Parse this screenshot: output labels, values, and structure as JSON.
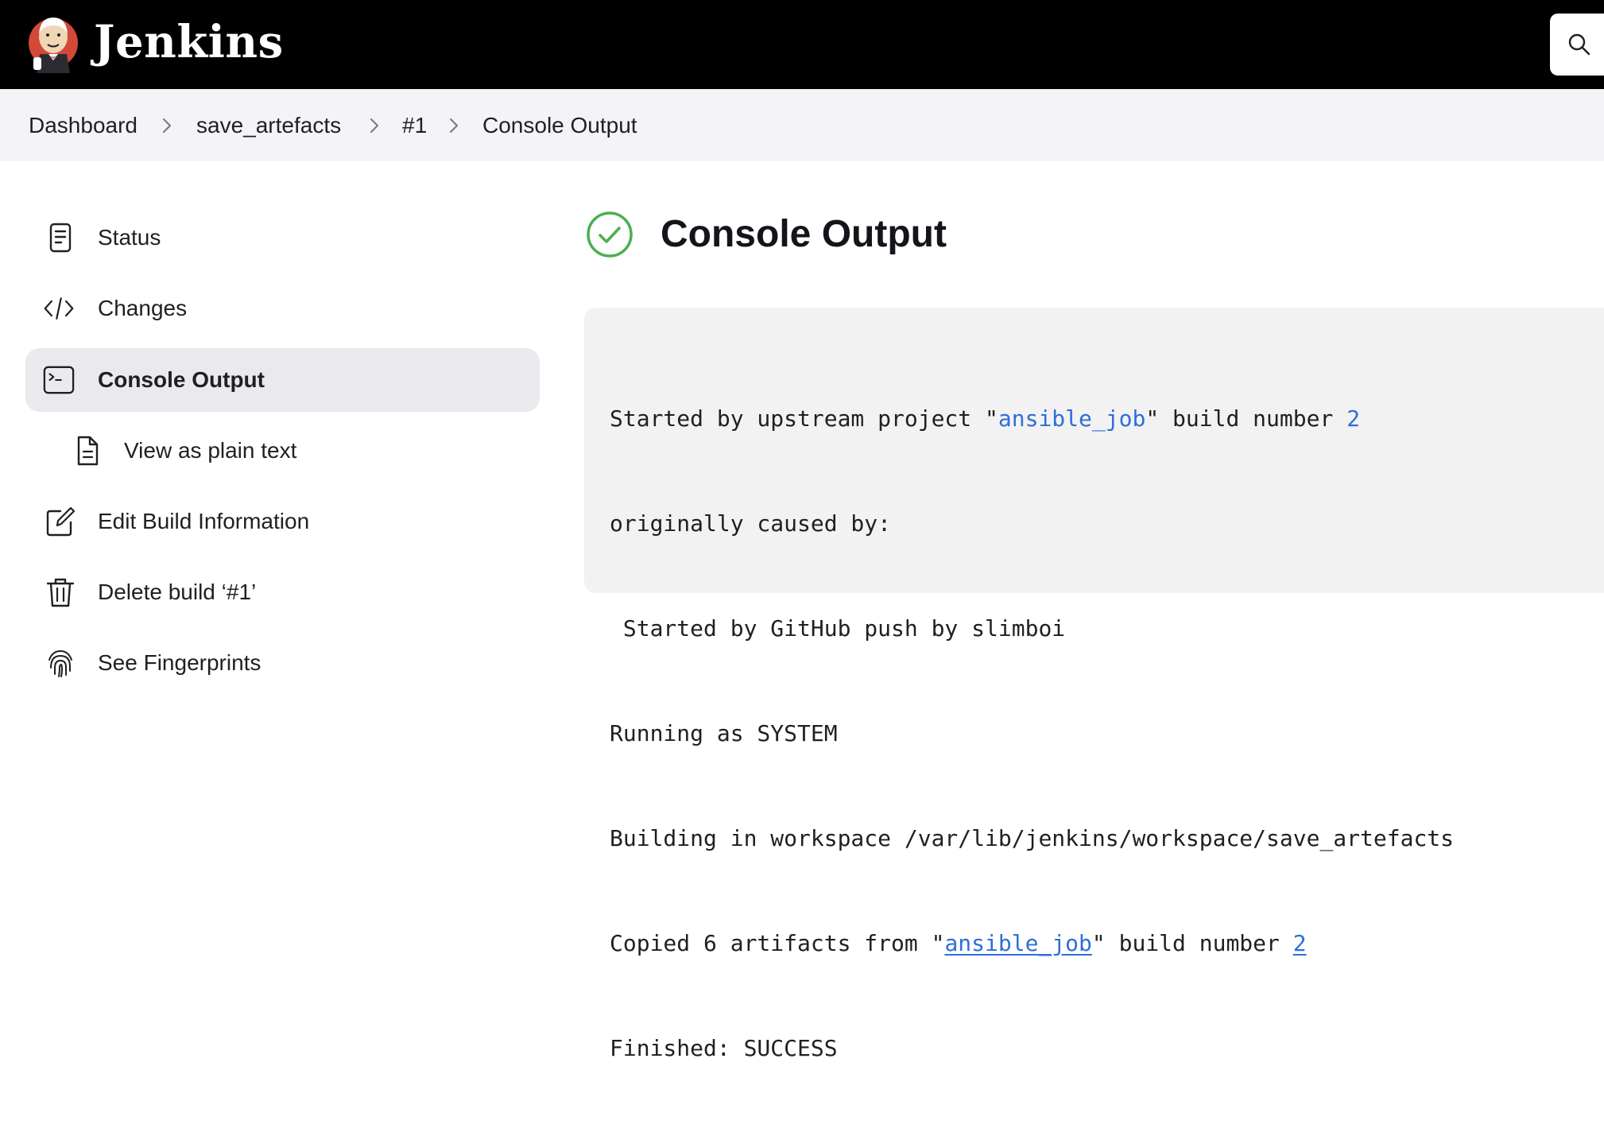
{
  "header": {
    "brand": "Jenkins",
    "logo_icon": "jenkins-butler-logo",
    "search_icon": "search-icon"
  },
  "breadcrumb": {
    "items": [
      "Dashboard",
      "save_artefacts",
      "#1",
      "Console Output"
    ],
    "separator_icon": "chevron-right-icon"
  },
  "sidebar": {
    "items": [
      {
        "label": "Status",
        "icon": "document-icon"
      },
      {
        "label": "Changes",
        "icon": "code-icon"
      },
      {
        "label": "Console Output",
        "icon": "terminal-icon",
        "active": true
      },
      {
        "label": "View as plain text",
        "icon": "file-text-icon"
      },
      {
        "label": "Edit Build Information",
        "icon": "edit-icon"
      },
      {
        "label": "Delete build ‘#1’",
        "icon": "trash-icon"
      },
      {
        "label": "See Fingerprints",
        "icon": "fingerprint-icon"
      }
    ]
  },
  "main": {
    "title": "Console Output",
    "status_icon": "success-check-icon",
    "colors": {
      "success": "#4caf50",
      "link": "#2d6fd8",
      "active_bg": "#e9e9ee"
    },
    "console": {
      "line1": {
        "pre": "Started by upstream project \"",
        "link": "ansible_job",
        "mid": "\" build number ",
        "num": "2"
      },
      "line2": "originally caused by:",
      "line3": " Started by GitHub push by slimboi",
      "line4": "Running as SYSTEM",
      "line5": "Building in workspace /var/lib/jenkins/workspace/save_artefacts",
      "line6": {
        "pre": "Copied 6 artifacts from \"",
        "link": "ansible_job",
        "mid": "\" build number ",
        "num": "2"
      },
      "line7": "Finished: SUCCESS"
    }
  }
}
